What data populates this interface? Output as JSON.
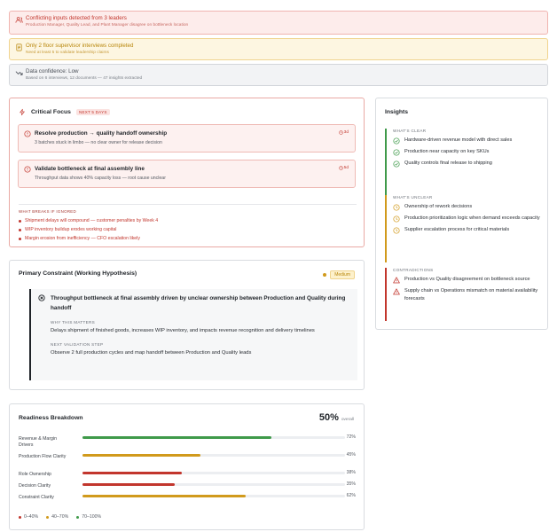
{
  "alerts": [
    {
      "title": "Conflicting inputs detected from 3 leaders",
      "sub": "Production Manager, Quality Lead, and Plant Manager disagree on bottleneck location",
      "icon": "users-icon"
    },
    {
      "title": "Only 2 floor supervisor interviews completed",
      "sub": "Need at least 5 to validate leadership claims",
      "icon": "document-icon"
    },
    {
      "title": "Data confidence: Low",
      "sub": "Based on 6 interviews, 12 documents — 47 insights extracted",
      "icon": "trend-down-icon"
    }
  ],
  "critical": {
    "title": "Critical Focus",
    "tag": "NEXT 5 DAYS",
    "items": [
      {
        "title": "Resolve production → quality handoff ownership",
        "sub": "3 batches stuck in limbo — no clear owner for release decision",
        "time": "3d"
      },
      {
        "title": "Validate bottleneck at final assembly line",
        "sub": "Throughput data shows 40% capacity loss — root cause unclear",
        "time": "5d"
      }
    ],
    "breaks_label": "WHAT BREAKS IF IGNORED",
    "breaks": [
      "Shipment delays will compound — customer penalties by Week 4",
      "WIP inventory buildup erodes working capital",
      "Margin erosion from inefficiency — CFO escalation likely"
    ]
  },
  "primary": {
    "title": "Primary Constraint (Working Hypothesis)",
    "badge": "Medium",
    "hypothesis": "Throughput bottleneck at final assembly driven by unclear ownership between Production and Quality during handoff",
    "why_label": "WHY THIS MATTERS",
    "why": "Delays shipment of finished goods, increases WIP inventory, and impacts revenue recognition and delivery timelines",
    "next_label": "NEXT VALIDATION STEP",
    "next": "Observe 2 full production cycles and map handoff between Production and Quality leads"
  },
  "readiness": {
    "title": "Readiness Breakdown",
    "overall": "50%",
    "overall_label": "overall",
    "rows": [
      {
        "label": "Revenue & Margin Drivers",
        "value": 72,
        "display": "72%"
      },
      {
        "label": "Production Flow Clarity",
        "value": 45,
        "display": "45%"
      },
      {
        "label": "Role Ownership",
        "value": 38,
        "display": "38%"
      },
      {
        "label": "Decision Clarity",
        "value": 35,
        "display": "35%"
      },
      {
        "label": "Constraint Clarity",
        "value": 62,
        "display": "62%"
      }
    ],
    "legend": [
      "0–40%",
      "40–70%",
      "70–100%"
    ]
  },
  "insights": {
    "title": "Insights",
    "clear_label": "WHAT'S CLEAR",
    "clear": [
      "Hardware-driven revenue model with direct sales",
      "Production near capacity on key SKUs",
      "Quality controls final release to shipping"
    ],
    "unclear_label": "WHAT'S UNCLEAR",
    "unclear": [
      "Ownership of rework decisions",
      "Production prioritization logic when demand exceeds capacity",
      "Supplier escalation process for critical materials"
    ],
    "contra_label": "CONTRADICTIONS",
    "contra": [
      "Production vs Quality disagreement on bottleneck source",
      "Supply chain vs Operations mismatch on material availability forecasts"
    ]
  },
  "colors": {
    "red": "#c2362d",
    "amber": "#d19a1c",
    "green": "#3f9a4a"
  }
}
